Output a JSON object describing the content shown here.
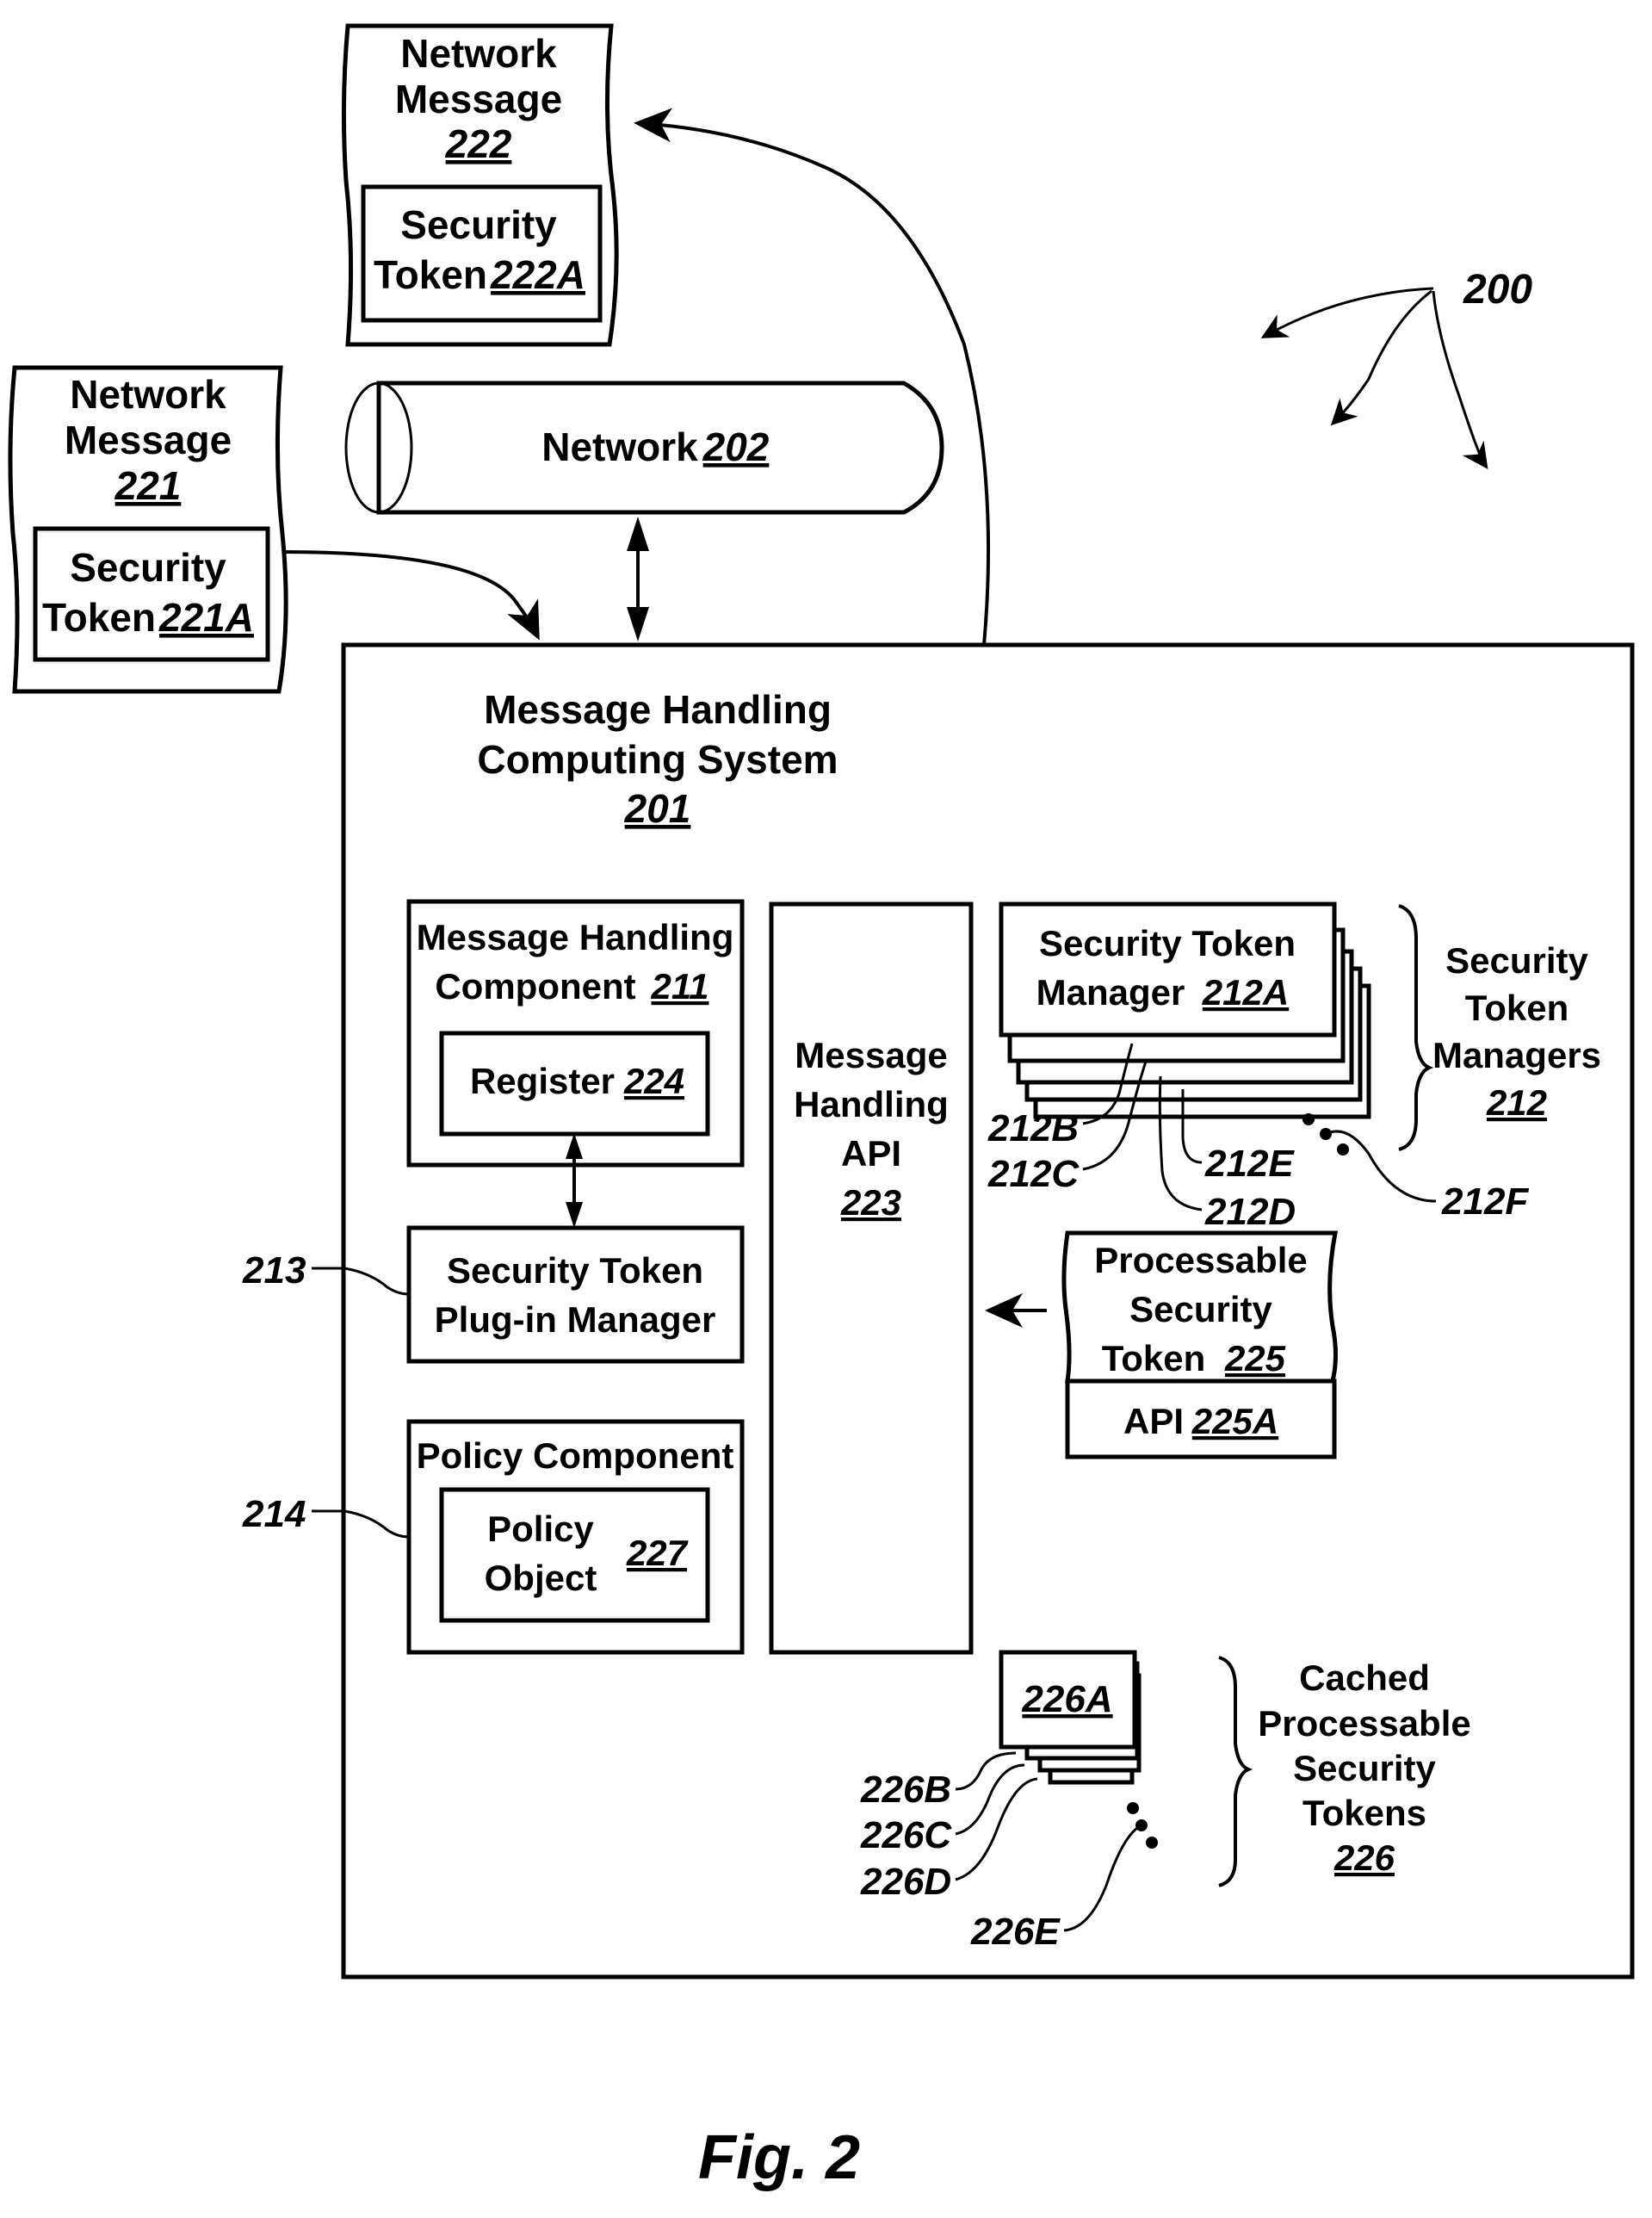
{
  "figure": {
    "caption": "Fig. 2",
    "reference_number": "200"
  },
  "network": {
    "label": "Network",
    "ref": "202"
  },
  "messages": [
    {
      "line1": "Network",
      "line2": "Message",
      "ref": "222",
      "token_line1": "Security",
      "token_line2": "Token",
      "token_ref": "222A"
    },
    {
      "line1": "Network",
      "line2": "Message",
      "ref": "221",
      "token_line1": "Security",
      "token_line2": "Token",
      "token_ref": "221A"
    }
  ],
  "system": {
    "line1": "Message Handling",
    "line2": "Computing System",
    "ref": "201"
  },
  "message_handling_component": {
    "line1": "Message Handling",
    "line2": "Component",
    "ref": "211",
    "register_label": "Register",
    "register_ref": "224"
  },
  "plugin_manager": {
    "line1": "Security Token",
    "line2": "Plug-in Manager",
    "callout": "213"
  },
  "policy_component": {
    "label": "Policy Component",
    "callout": "214",
    "object_line1": "Policy",
    "object_line2": "Object",
    "object_ref": "227"
  },
  "api": {
    "line1": "Message",
    "line2": "Handling",
    "line3": "API",
    "ref": "223"
  },
  "token_managers": {
    "first_line1": "Security Token",
    "first_line2": "Manager",
    "first_ref": "212A",
    "stack_refs": [
      "212B",
      "212C",
      "212D",
      "212E",
      "212F"
    ],
    "group_line1": "Security",
    "group_line2": "Token",
    "group_line3": "Managers",
    "group_ref": "212"
  },
  "processable_token": {
    "line1": "Processable",
    "line2": "Security",
    "line3": "Token",
    "ref": "225",
    "api_label": "API",
    "api_ref": "225A"
  },
  "cached_tokens": {
    "first_ref": "226A",
    "stack_refs": [
      "226B",
      "226C",
      "226D",
      "226E"
    ],
    "group_line1": "Cached",
    "group_line2": "Processable",
    "group_line3": "Security",
    "group_line4": "Tokens",
    "group_ref": "226"
  }
}
